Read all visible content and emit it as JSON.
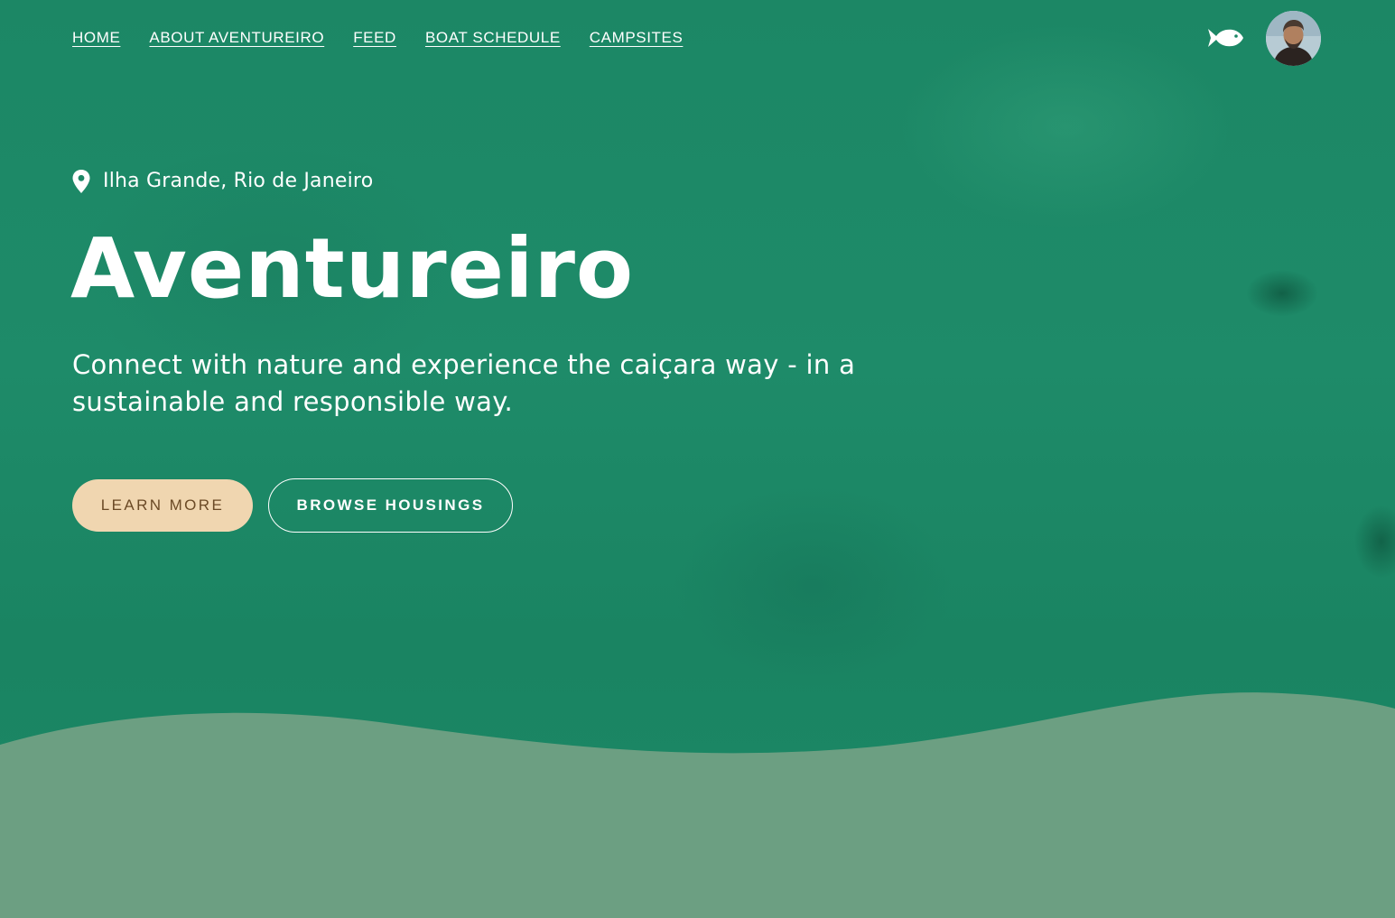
{
  "nav": {
    "items": [
      {
        "label": "HOME"
      },
      {
        "label": "ABOUT AVENTUREIRO"
      },
      {
        "label": "FEED"
      },
      {
        "label": "BOAT SCHEDULE"
      },
      {
        "label": "CAMPSITES"
      }
    ]
  },
  "header": {
    "logo_icon": "fish-icon",
    "avatar_icon": "user-avatar"
  },
  "hero": {
    "location_icon": "map-pin-icon",
    "location": "Ilha Grande, Rio de Janeiro",
    "title": "Aventureiro",
    "tagline": "Connect with nature and experience the caiçara way - in a sustainable and responsible way.",
    "primary_button": "LEARN MORE",
    "secondary_button": "BROWSE HOUSINGS"
  },
  "colors": {
    "sea": "#1c8765",
    "wave": "#6c9f82",
    "primary_button_bg": "#f0d6b0",
    "primary_button_text": "#6b4a26",
    "text": "#ffffff"
  }
}
